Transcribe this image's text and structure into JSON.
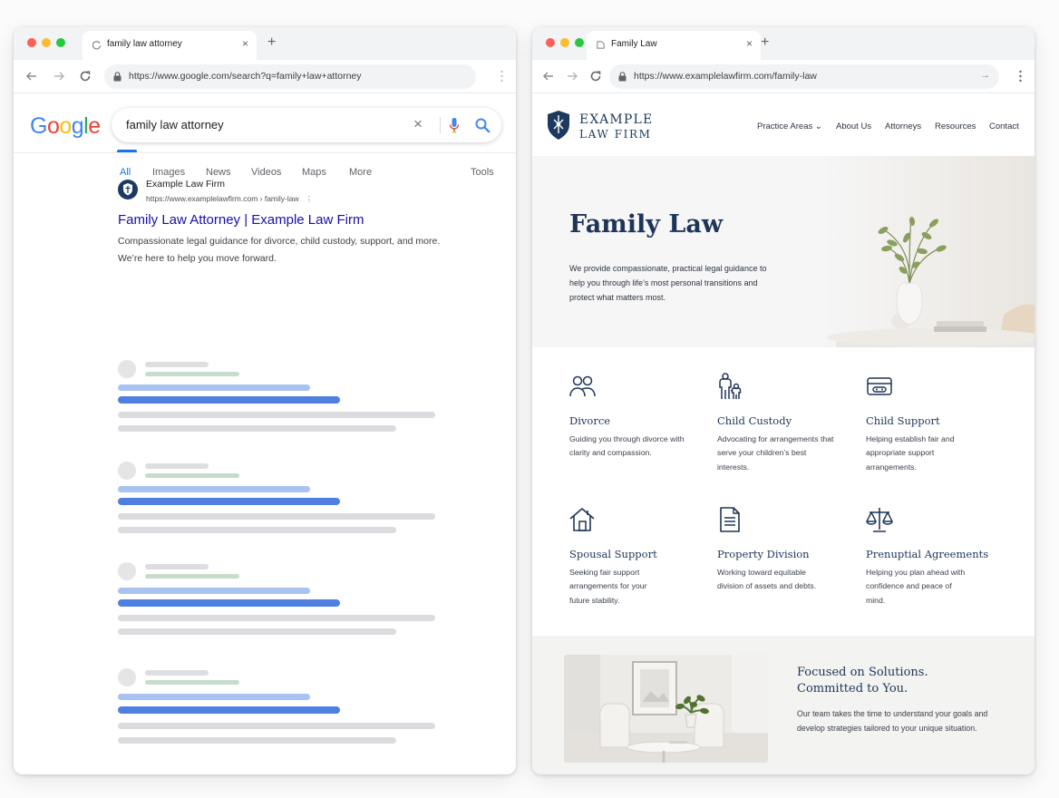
{
  "left_window": {
    "tab": {
      "title": "family law attorney",
      "favicon": "google-g-icon",
      "close_icon": "×"
    },
    "new_tab_icon": "+",
    "address_bar": {
      "url": "https://www.google.com/search?q=family+law+attorney"
    },
    "search": {
      "logo": {
        "letters": [
          "G",
          "o",
          "o",
          "g",
          "l",
          "e"
        ],
        "colors": [
          "#4285F4",
          "#EA4335",
          "#FBBC05",
          "#4285F4",
          "#34A853",
          "#EA4335"
        ]
      },
      "query": "family law attorney",
      "clear_icon": "×",
      "tabs": [
        {
          "label": "All",
          "active": true
        },
        {
          "label": "Images"
        },
        {
          "label": "News"
        },
        {
          "label": "Videos"
        },
        {
          "label": "Maps"
        },
        {
          "label": "More"
        }
      ],
      "tools_label": "Tools"
    },
    "result": {
      "site_name": "Example Law Firm",
      "breadcrumb_url": "https://www.examplelawfirm.com › family-law",
      "menu_icon": "⋮",
      "title": "Family Law Attorney | Example Law Firm",
      "description": "Compassionate legal guidance for divorce, child custody, support, and more. We’re here to help you move forward."
    }
  },
  "right_window": {
    "tab": {
      "title": "Family Law",
      "close_icon": "×"
    },
    "new_tab_icon": "+",
    "address_bar": {
      "url": "https://www.examplelawfirm.com/family-law",
      "end_icon": "→"
    },
    "site": {
      "logo_line1": "EXAMPLE",
      "logo_line2": "LAW FIRM",
      "nav": [
        {
          "label": "Practice Areas ⌄"
        },
        {
          "label": "About Us"
        },
        {
          "label": "Attorneys"
        },
        {
          "label": "Resources"
        },
        {
          "label": "Contact"
        }
      ],
      "hero": {
        "title": "Family Law",
        "text": "We provide compassionate, practical legal guidance to help you through life’s most personal transitions and protect what matters most."
      },
      "practice_areas": [
        {
          "icon": "people-icon",
          "title": "Divorce",
          "text": "Guiding you through divorce with clarity and compassion."
        },
        {
          "icon": "parent-child-icon",
          "title": "Child Custody",
          "text": "Advocating for arrangements that serve your children’s best interests."
        },
        {
          "icon": "wallet-icon",
          "title": "Child Support",
          "text": "Helping establish fair and appropriate support arrangements."
        },
        {
          "icon": "house-icon",
          "title": "Spousal Support",
          "text": "Seeking fair support arrangements for your future stability."
        },
        {
          "icon": "document-icon",
          "title": "Property Division",
          "text": "Working toward equitable division of assets and debts."
        },
        {
          "icon": "scales-icon",
          "title": "Prenuptial Agreements",
          "text": "Helping you plan ahead with confidence and peace of mind."
        }
      ],
      "feature": {
        "title_line1": "Focused on Solutions.",
        "title_line2": "Committed to You.",
        "text": "Our team takes the time to understand your goals and develop strategies tailored to your unique situation."
      }
    }
  }
}
